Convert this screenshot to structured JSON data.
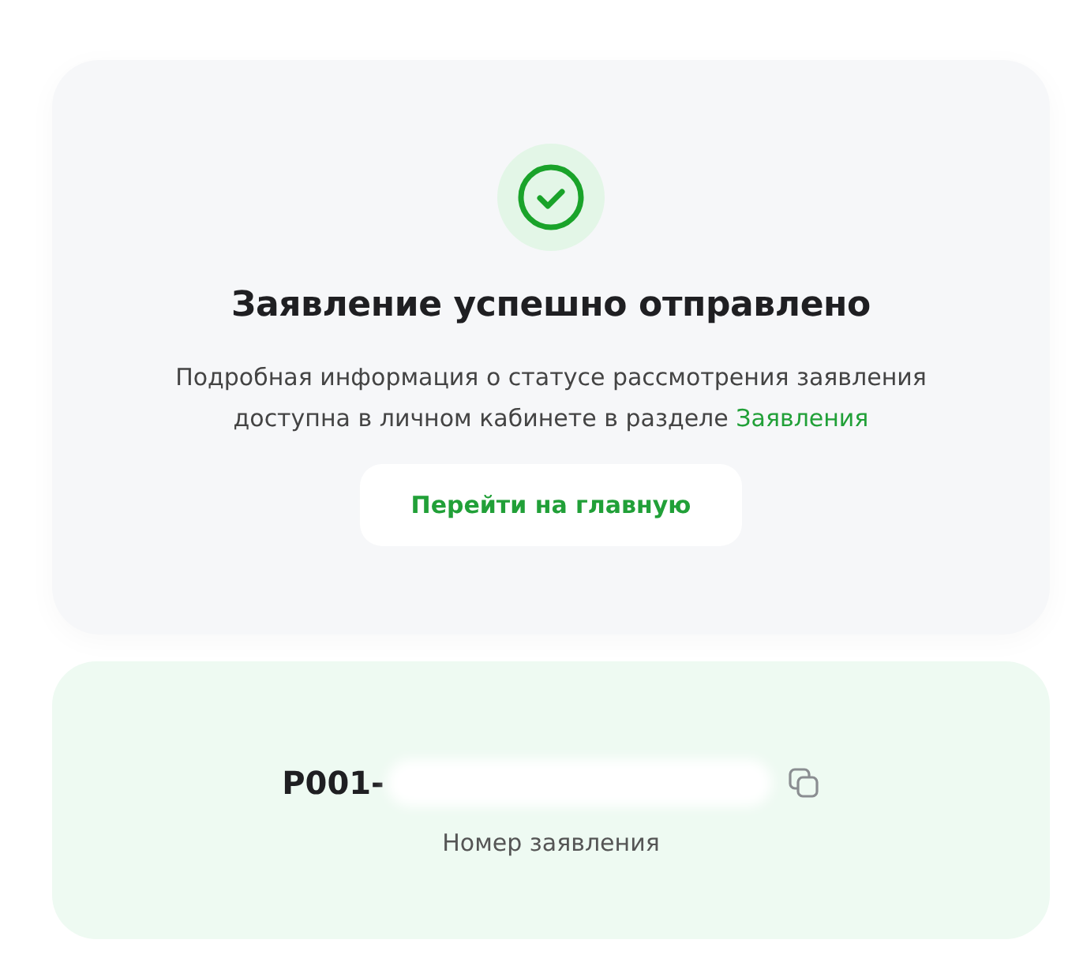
{
  "result_card": {
    "title": "Заявление успешно отправлено",
    "description": "Подробная информация о статусе рассмотрения заявления доступна в личном кабинете в разделе",
    "description_link": "Заявления",
    "button": "Перейти на главную"
  },
  "application_card": {
    "number": "P001-",
    "label": "Номер заявления"
  }
}
